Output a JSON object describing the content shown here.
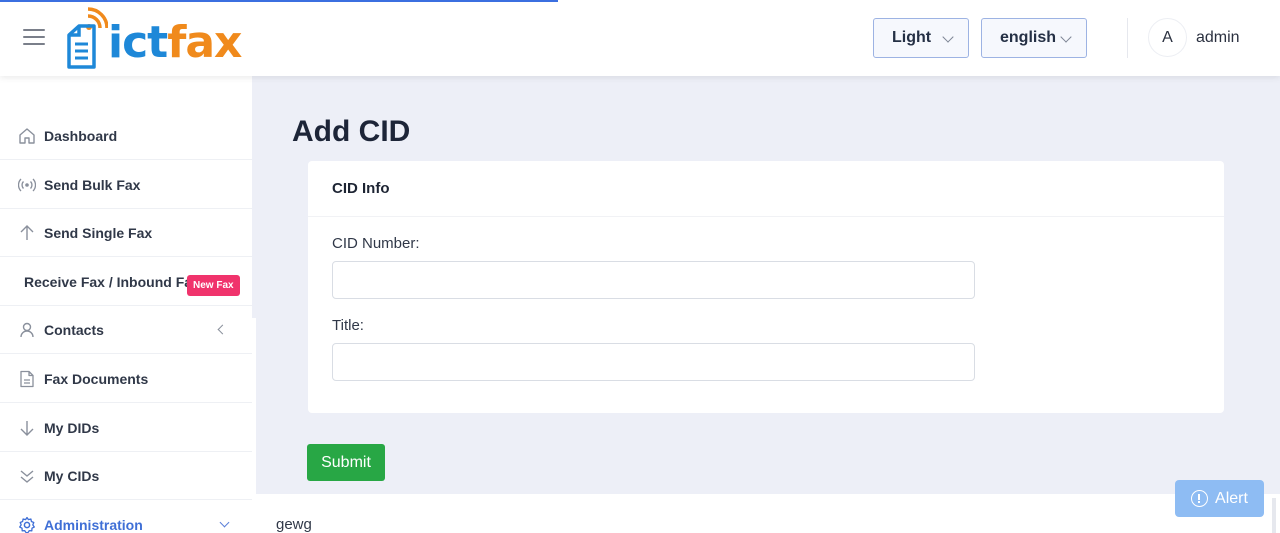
{
  "app": {
    "logo_text_left": "ict",
    "logo_text_right": "fax",
    "colors": {
      "logo_blue": "#1e88d8",
      "logo_orange": "#f08a1c",
      "accent": "#3f6fd6",
      "submit_green": "#28a745",
      "badge_pink": "#f0336c",
      "alert_blue": "#8ebcf3"
    }
  },
  "header": {
    "menu_icon": "hamburger-icon",
    "theme_select": {
      "value": "Light"
    },
    "language_select": {
      "value": "english"
    },
    "avatar_initial": "A",
    "username": "admin"
  },
  "sidebar": {
    "items": [
      {
        "label": "Dashboard",
        "icon": "home-icon"
      },
      {
        "label": "Send Bulk Fax",
        "icon": "broadcast-icon"
      },
      {
        "label": "Send Single Fax",
        "icon": "arrow-up-icon"
      },
      {
        "label": "Receive Fax / Inbound Fax",
        "icon": "",
        "badge": "New Fax"
      },
      {
        "label": "Contacts",
        "icon": "user-icon"
      },
      {
        "label": "Fax Documents",
        "icon": "document-icon"
      },
      {
        "label": "My DIDs",
        "icon": "arrow-down-icon"
      },
      {
        "label": "My CIDs",
        "icon": "double-chevron-down-icon"
      },
      {
        "label": "Administration",
        "icon": "gear-icon",
        "active": true
      }
    ]
  },
  "main": {
    "page_title": "Add CID",
    "card": {
      "title": "CID Info",
      "fields": [
        {
          "label": "CID Number:",
          "value": "",
          "placeholder": ""
        },
        {
          "label": "Title:",
          "value": "",
          "placeholder": ""
        }
      ]
    },
    "submit_label": "Submit"
  },
  "footer": {
    "text": "gewg"
  },
  "alert": {
    "label": "Alert",
    "icon": "info-circle-icon"
  }
}
